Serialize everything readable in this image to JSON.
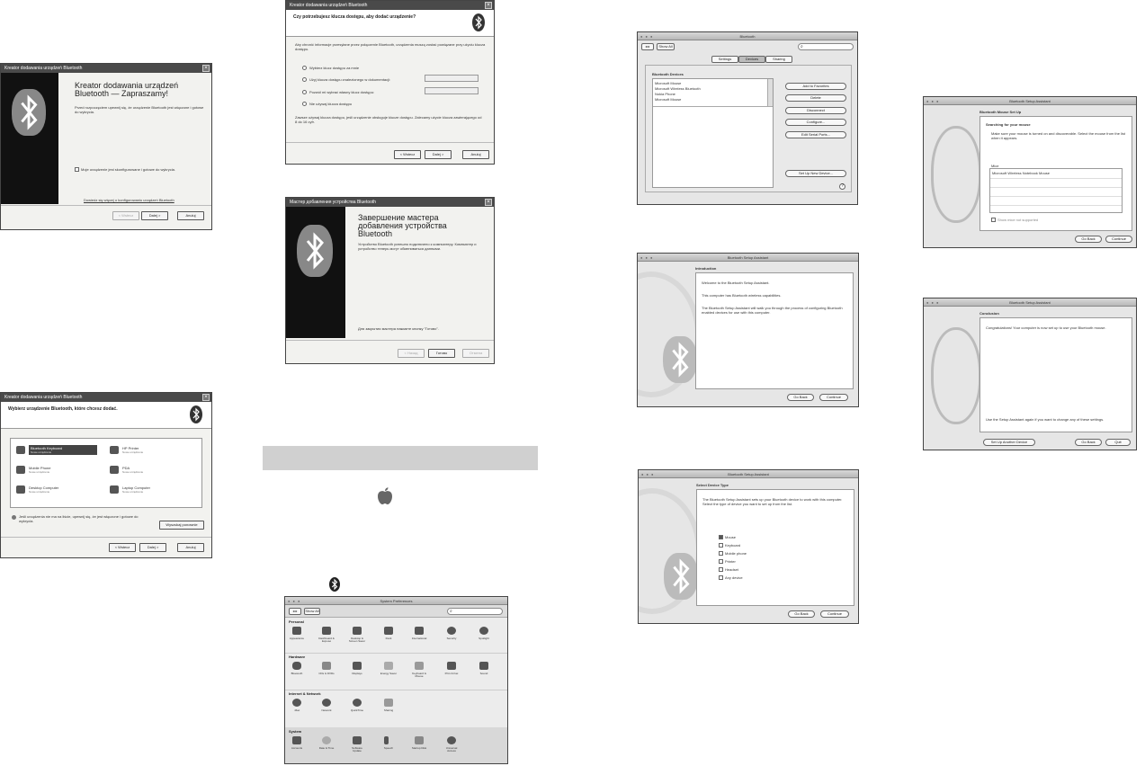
{
  "xp_titlebar": "Kreator dodawania urządzeń Bluetooth",
  "w1": {
    "title_lines": [
      "Kreator dodawania urządzeń",
      "Bluetooth — Zapraszamy!"
    ],
    "body": "Przed rozpoczęciem upewnij się, że urządzenie Bluetooth jest włączone i gotowe do wykrycia.",
    "checkbox": "Moje urządzenie jest skonfigurowane i gotowe do wykrycia.",
    "link": "Dowiedz się więcej o konfigurowaniu urządzeń Bluetooth",
    "btn_back": "< Wstecz",
    "btn_next": "Dalej >",
    "btn_cancel": "Anuluj"
  },
  "w2": {
    "heading": "Czy potrzebujesz klucza dostępu, aby dodać urządzenie?",
    "intro": "Aby chronić informacje przesyłane przez połączenie Bluetooth, urządzenia muszą zostać powiązane przy użyciu klucza dostępu.",
    "options": [
      "Wybierz klucz dostępu za mnie",
      "Użyj klucza dostępu znalezionego w dokumentacji:",
      "Pozwól mi wybrać własny klucz dostępu:",
      "Nie używaj klucza dostępu"
    ],
    "note": "Zawsze używaj klucza dostępu, jeśli urządzenie obsługuje klucze dostępu. Zalecamy użycie klucza zawierającego od 8 do 16 cyfr.",
    "btn_back": "< Wstecz",
    "btn_next": "Dalej >",
    "btn_cancel": "Anuluj"
  },
  "w3": {
    "titlebar": "Мастер добавления устройства Bluetooth",
    "title_lines": [
      "Завершение мастера",
      "добавления устройства",
      "Bluetooth"
    ],
    "body": "Устройство Bluetooth успешно подключено к компьютеру. Компьютер и устройство теперь могут обмениваться данными.",
    "finish": "Для закрытия мастера нажмите кнопку \"Готово\".",
    "btn_back": "< Назад",
    "btn_finish": "Готово",
    "btn_cancel": "Отмена"
  },
  "w4": {
    "heading": "Wybierz urządzenie Bluetooth, które chcesz dodać.",
    "devices": [
      {
        "name": "Bluetooth Keyboard",
        "sub": "Nowe urządzenie"
      },
      {
        "name": "HP Printer",
        "sub": "Nowe urządzenie"
      },
      {
        "name": "Mobile Phone",
        "sub": "Nowe urządzenie"
      },
      {
        "name": "PDA",
        "sub": "Nowe urządzenie"
      },
      {
        "name": "Desktop Computer",
        "sub": "Nowe urządzenie"
      },
      {
        "name": "Laptop Computer",
        "sub": "Nowe urządzenie"
      }
    ],
    "hint": "Jeśli urządzenia nie ma na liście, upewnij się, że jest włączone i gotowe do wykrycia.",
    "btn_search": "Wyszukaj ponownie",
    "btn_back": "< Wstecz",
    "btn_next": "Dalej >",
    "btn_cancel": "Anuluj"
  },
  "prefs": {
    "title": "System Preferences",
    "show_all": "Show All",
    "sections": [
      "Personal",
      "Hardware",
      "Internet & Network",
      "System"
    ],
    "personal": [
      "Appearance",
      "Dashboard & Exposé",
      "Desktop & Screen Saver",
      "Dock",
      "International",
      "Security",
      "Spotlight"
    ],
    "hardware": [
      "Bluetooth",
      "CDs & DVDs",
      "Displays",
      "Energy Saver",
      "Keyboard & Mouse",
      "Print & Fax",
      "Sound"
    ],
    "internet": [
      ".Mac",
      "Network",
      "QuickTime",
      "Sharing"
    ],
    "system": [
      "Accounts",
      "Date & Time",
      "Software Update",
      "Speech",
      "Startup Disk",
      "Universal Access"
    ]
  },
  "mac_bt": {
    "title": "Bluetooth",
    "show_all": "Show All",
    "tabs": [
      "Settings",
      "Devices",
      "Sharing"
    ],
    "list_label": "Bluetooth Devices",
    "devices": [
      "Microsoft Mouse",
      "Microsoft Wireless Bluetooth",
      "Nokia Phone",
      "Microsoft Mouse"
    ],
    "buttons": [
      "Add to Favorites",
      "Delete",
      "Disconnect",
      "Configure...",
      "Edit Serial Ports...",
      "Set Up New Device..."
    ]
  },
  "assistant": {
    "title": "Bluetooth Setup Assistant",
    "intro_heading": "Introduction",
    "intro_lines": [
      "Welcome to the Bluetooth Setup Assistant.",
      "This computer has Bluetooth wireless capabilities.",
      "The Bluetooth Setup Assistant will walk you through the process of configuring Bluetooth enabled devices for use with this computer."
    ],
    "type_heading": "Select Device Type",
    "type_body": "The Bluetooth Setup Assistant sets up your Bluetooth device to work with this computer. Select the type of device you want to set up from the list.",
    "types": [
      "Mouse",
      "Keyboard",
      "Mobile phone",
      "Printer",
      "Headset",
      "Any device"
    ],
    "btn_back": "Go Back",
    "btn_continue": "Continue"
  },
  "mouse_setup": {
    "heading": "Bluetooth Mouse Set Up",
    "searching": "Searching for your mouse",
    "instructions": "Make sure your mouse is turned on and discoverable. Select the mouse from the list when it appears.",
    "list_label": "Mice",
    "found": "Microsoft Wireless Notebook Mouse",
    "checkbox": "Show mice not supported",
    "btn_back": "Go Back",
    "btn_continue": "Continue"
  },
  "conclusion": {
    "heading": "Conclusion",
    "body": "Congratulations! Your computer is now set up to use your Bluetooth mouse.",
    "footer": "Use the Setup Assistant again if you want to change any of these settings.",
    "btn_another": "Set Up Another Device",
    "btn_back": "Go Back",
    "btn_quit": "Quit"
  }
}
